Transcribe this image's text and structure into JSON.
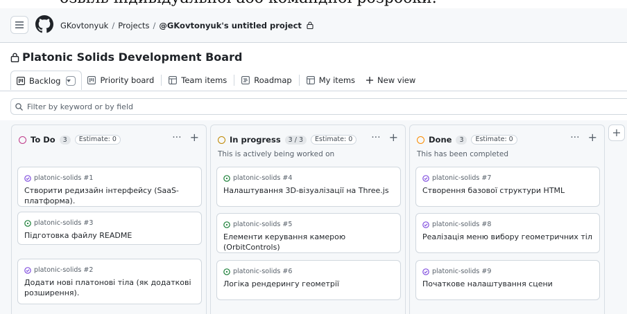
{
  "top_text": "озвіль індивідуальної або командної розробки.",
  "header": {
    "breadcrumb": [
      "GKovtonyuk",
      "Projects",
      "@GKovtonyuk's untitled project"
    ],
    "icons": {
      "menu": "hamburger-icon",
      "logo": "github-logo-icon",
      "private": "lock-icon"
    }
  },
  "board": {
    "title": "Platonic Solids Development Board"
  },
  "views": [
    {
      "label": "Backlog",
      "icon": "board-icon"
    },
    {
      "label": "Priority board",
      "icon": "board-icon"
    },
    {
      "label": "Team items",
      "icon": "table-icon"
    },
    {
      "label": "Roadmap",
      "icon": "roadmap-icon"
    },
    {
      "label": "My items",
      "icon": "table-icon"
    },
    {
      "label": "New view",
      "icon": "plus-icon"
    }
  ],
  "filter": {
    "placeholder": "Filter by keyword or by field"
  },
  "columns": [
    {
      "name": "To Do",
      "count": "3",
      "estimate": "Estimate: 0",
      "description": "",
      "color": "#bf3989",
      "cards": [
        {
          "ref": "platonic-solids #1",
          "title": "Створити редизайн інтерфейсу (SaaS-платформа).",
          "status": "closed"
        },
        {
          "ref": "platonic-solids #3",
          "title": "Підготовка файлу README",
          "status": "open"
        },
        {
          "ref": "platonic-solids #2",
          "title": "Додати нові платонові тіла (як додаткові розширення).",
          "status": "closed"
        }
      ]
    },
    {
      "name": "In progress",
      "count": "3 / 3",
      "estimate": "Estimate: 0",
      "description": "This is actively being worked on",
      "color": "#bf8700",
      "cards": [
        {
          "ref": "platonic-solids #4",
          "title": "Налаштування 3D-візуалізації на Three.js",
          "status": "open"
        },
        {
          "ref": "platonic-solids #5",
          "title": "Елементи керування камерою (OrbitControls)",
          "status": "open"
        },
        {
          "ref": "platonic-solids #6",
          "title": "Логіка рендерингу геометрії",
          "status": "open"
        }
      ]
    },
    {
      "name": "Done",
      "count": "3",
      "estimate": "Estimate: 0",
      "description": "This has been completed",
      "color": "#fb8c00",
      "cards": [
        {
          "ref": "platonic-solids #7",
          "title": "Створення базової структури HTML",
          "status": "closed"
        },
        {
          "ref": "platonic-solids #8",
          "title": "Реалізація меню вибору геометричних тіл",
          "status": "closed"
        },
        {
          "ref": "platonic-solids #9",
          "title": "Початкове налаштування сцени",
          "status": "closed"
        }
      ]
    }
  ],
  "colors": {
    "open_issue": "#1a7f37",
    "closed_issue": "#8250df",
    "border": "#d0d7de",
    "muted": "#57606a"
  }
}
